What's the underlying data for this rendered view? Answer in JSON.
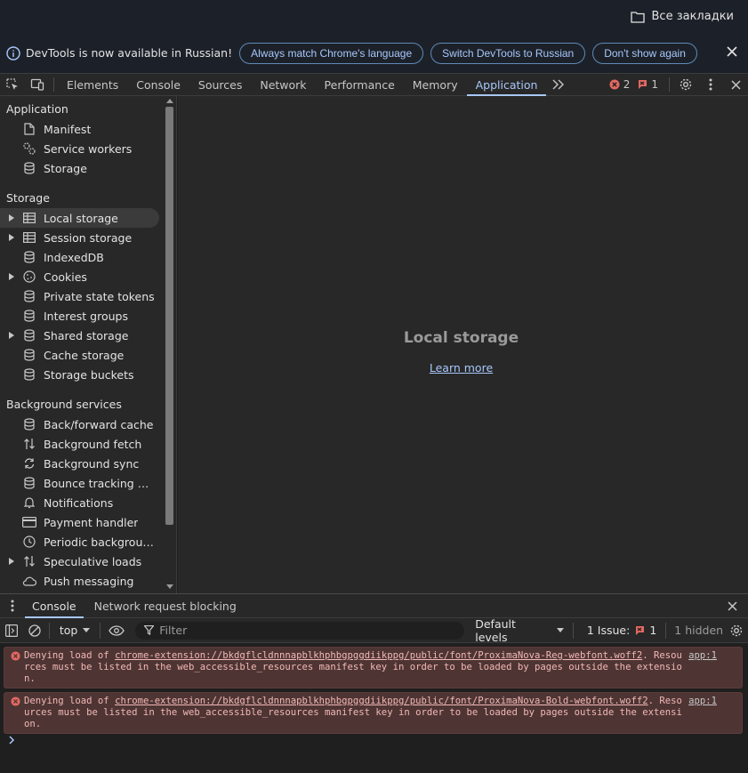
{
  "bookmarks": {
    "folder_label": "Все закладки"
  },
  "infobar": {
    "message": "DevTools is now available in Russian!",
    "buttons": [
      "Always match Chrome's language",
      "Switch DevTools to Russian",
      "Don't show again"
    ]
  },
  "tabs": {
    "items": [
      "Elements",
      "Console",
      "Sources",
      "Network",
      "Performance",
      "Memory",
      "Application"
    ],
    "active": "Application",
    "errors_count": "2",
    "issues_count": "1"
  },
  "sidebar": {
    "application_header": "Application",
    "application_items": [
      "Manifest",
      "Service workers",
      "Storage"
    ],
    "storage_header": "Storage",
    "storage_items": [
      "Local storage",
      "Session storage",
      "IndexedDB",
      "Cookies",
      "Private state tokens",
      "Interest groups",
      "Shared storage",
      "Cache storage",
      "Storage buckets"
    ],
    "background_header": "Background services",
    "background_items": [
      "Back/forward cache",
      "Background fetch",
      "Background sync",
      "Bounce tracking miti...",
      "Notifications",
      "Payment handler",
      "Periodic backgroun...",
      "Speculative loads",
      "Push messaging"
    ]
  },
  "main": {
    "title": "Local storage",
    "learn_more": "Learn more"
  },
  "drawer": {
    "tabs": [
      "Console",
      "Network request blocking"
    ],
    "context": "top",
    "filter_placeholder": "Filter",
    "levels": "Default levels",
    "issues_label": "1 Issue:",
    "issues_count": "1",
    "hidden_label": "1 hidden",
    "messages": [
      {
        "prefix": "Denying load of ",
        "url": "chrome-extension://bkdgflcldnnnapblkhphbgpggdiikppg/public/font/ProximaNova-Reg-webfont.woff2",
        "suffix": ". Resources must be listed in the web_accessible_resources manifest key in order to be loaded by pages outside the extension.",
        "source": "app:1"
      },
      {
        "prefix": "Denying load of ",
        "url": "chrome-extension://bkdgflcldnnnapblkhphbgpggdiikppg/public/font/ProximaNova-Bold-webfont.woff2",
        "suffix": ". Resources must be listed in the web_accessible_resources manifest key in order to be loaded by pages outside the extension.",
        "source": "app:1"
      }
    ]
  },
  "colors": {
    "accent": "#a8c7fa",
    "error": "#f28b82",
    "error_bg": "#4e3534",
    "panel_bg": "#282828"
  }
}
